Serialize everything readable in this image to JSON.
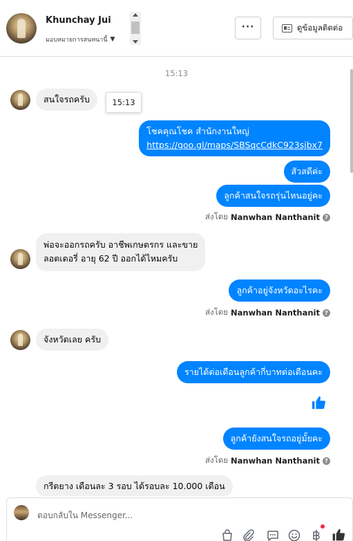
{
  "header": {
    "contact_name": "Khunchay Jui",
    "assign_label": "มอบหมายการสนทนานี้",
    "more_label": "···",
    "contact_info_label": "ดูข้อมูลติดต่อ"
  },
  "chat": {
    "timestamp": "15:13",
    "tooltip_time": "15:13",
    "messages": [
      {
        "from": "customer",
        "text": "สนใจรถครับ"
      },
      {
        "from": "page",
        "text_line1": "โชคคุณโชค สำนักงานใหญ่",
        "link": "https://goo.gl/maps/SBSqcCdkC923sjbx7"
      },
      {
        "from": "page",
        "text": "สัวสดีค่ะ"
      },
      {
        "from": "page",
        "text": "ลูกค้าสนใจรถรุ่นไหนอยู่คะ"
      },
      {
        "from": "customer",
        "text_line1": "พ่อจะออกรถครับ อาชีพเกษตรกร และขาย",
        "text_line2": "ลอตเตอรี่ อายุ 62 ปี ออกได้ไหมครับ"
      },
      {
        "from": "page",
        "text": "ลูกค้าอยู่จังหวัดอะไรคะ"
      },
      {
        "from": "customer",
        "text": "จังหวัดเลย ครับ"
      },
      {
        "from": "page",
        "text": "รายได้ต่อเดือนลูกค้ากี่บาทต่อเดือนคะ"
      },
      {
        "from": "page",
        "text": "ลูกค้ายังสนใจรถอยู่มั้ยคะ"
      },
      {
        "from": "customer",
        "text": "กรีดยาง เดือนละ 3 รอบ ได้รอบละ 10.000  เดือน"
      }
    ],
    "sent_by_prefix": "ส่งโดย",
    "sent_by_name": "Nanwhan Nanthanit",
    "help_glyph": "?"
  },
  "composer": {
    "placeholder": "ตอบกลับใน Messenger...",
    "tools": [
      "bag-icon",
      "paperclip-icon",
      "quick-reply-icon",
      "emoji-icon",
      "baht-icon",
      "like-icon"
    ]
  },
  "colors": {
    "outgoing_bubble": "#0084ff",
    "incoming_bubble": "#f0f0f0",
    "notification_dot": "#f02849"
  }
}
